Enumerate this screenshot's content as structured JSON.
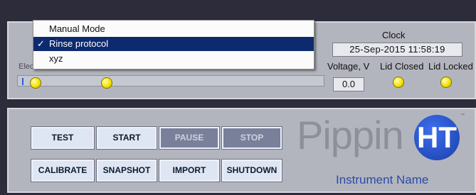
{
  "menu": {
    "items": [
      {
        "label": "Manual Mode",
        "checked": false
      },
      {
        "label": "Rinse protocol",
        "checked": true
      },
      {
        "label": "xyz",
        "checked": false
      }
    ],
    "check_glyph": "✓"
  },
  "top_panel": {
    "hidden_label": "Electrode status"
  },
  "status": {
    "clock_label": "Clock",
    "clock_value": "25-Sep-2015   11:58:19",
    "voltage_label": "Voltage, V",
    "voltage_value": "0.0",
    "lid_closed_label": "Lid Closed",
    "lid_locked_label": "Lid Locked",
    "led_color": "#f5e400"
  },
  "controls": {
    "test": "TEST",
    "start": "START",
    "pause": "PAUSE",
    "stop": "STOP",
    "calibrate": "CALIBRATE",
    "snapshot": "SNAPSHOT",
    "import": "IMPORT",
    "shutdown": "SHUTDOWN"
  },
  "logo": {
    "pippin": "Pippin",
    "ht": "HT",
    "tm": "™",
    "instrument_name": "Instrument Name",
    "brand_color": "#1a3fa8"
  }
}
